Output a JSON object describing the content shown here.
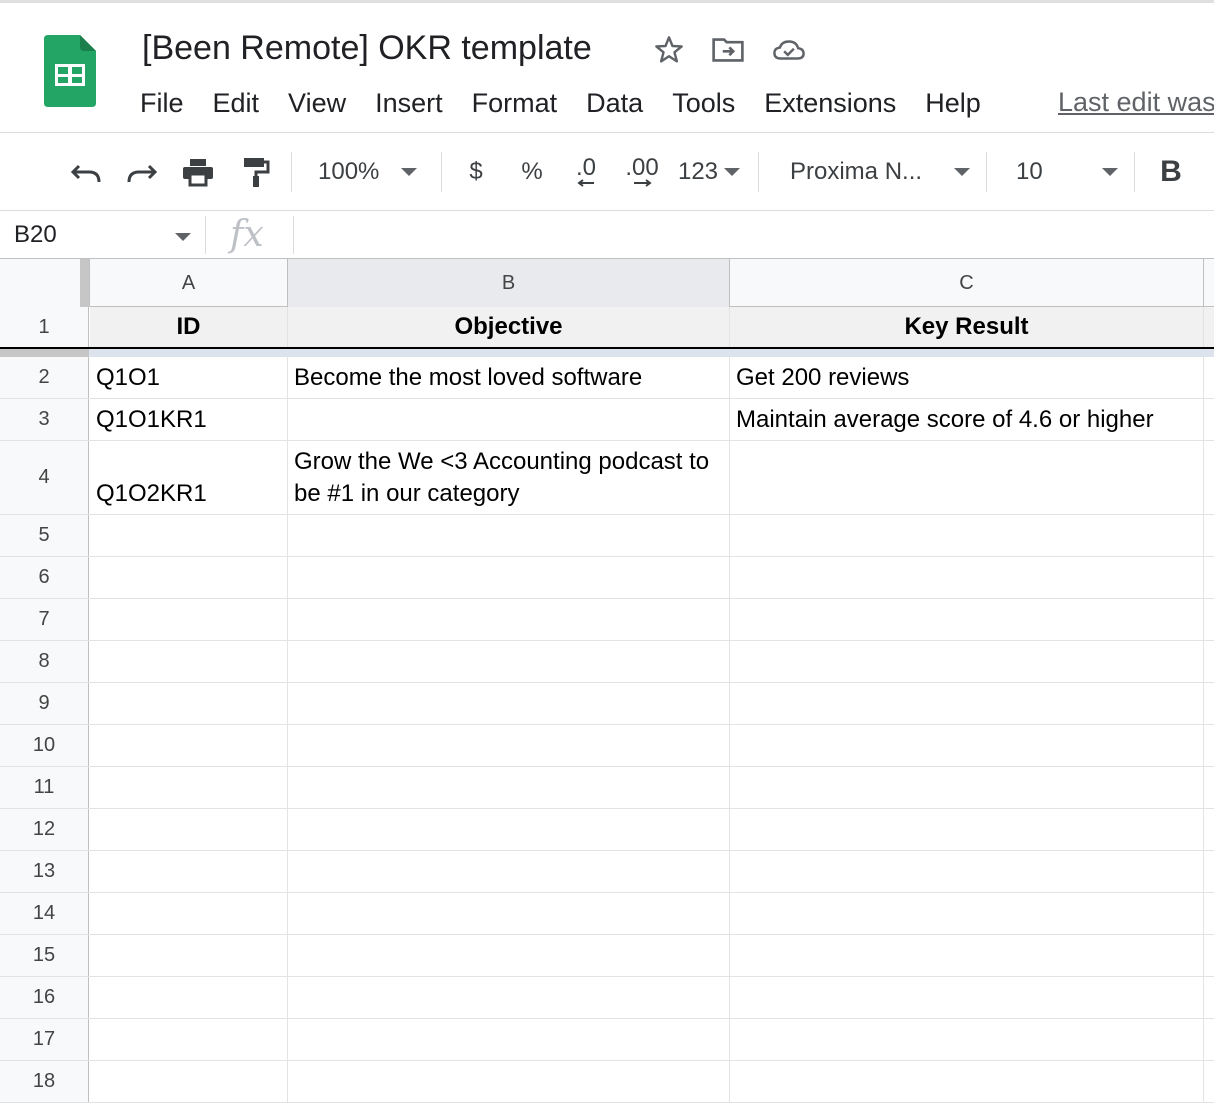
{
  "app": {
    "title": "[Been Remote] OKR template",
    "last_edit": "Last edit was"
  },
  "menu": [
    "File",
    "Edit",
    "View",
    "Insert",
    "Format",
    "Data",
    "Tools",
    "Extensions",
    "Help"
  ],
  "toolbar": {
    "zoom": "100%",
    "currency": "$",
    "percent": "%",
    "decrease_decimal": ".0",
    "increase_decimal": ".00",
    "more_formats": "123",
    "font": "Proxima N...",
    "font_size": "10",
    "bold": "B"
  },
  "formula_bar": {
    "cell_ref": "B20",
    "fx": "fx",
    "value": ""
  },
  "columns": [
    "A",
    "B",
    "C"
  ],
  "rows": [
    {
      "num": "1",
      "cells": [
        "ID",
        "Objective",
        "Key Result"
      ]
    },
    {
      "num": "2",
      "cells": [
        "Q1O1",
        "Become the most loved software",
        "Get 200 reviews"
      ]
    },
    {
      "num": "3",
      "cells": [
        "Q1O1KR1",
        "",
        "Maintain average score of 4.6 or higher"
      ]
    },
    {
      "num": "4",
      "cells": [
        "Q1O2KR1",
        "Grow the We <3 Accounting podcast to be #1 in our category",
        ""
      ]
    },
    {
      "num": "5",
      "cells": [
        "",
        "",
        ""
      ]
    },
    {
      "num": "6",
      "cells": [
        "",
        "",
        ""
      ]
    },
    {
      "num": "7",
      "cells": [
        "",
        "",
        ""
      ]
    },
    {
      "num": "8",
      "cells": [
        "",
        "",
        ""
      ]
    },
    {
      "num": "9",
      "cells": [
        "",
        "",
        ""
      ]
    },
    {
      "num": "10",
      "cells": [
        "",
        "",
        ""
      ]
    },
    {
      "num": "11",
      "cells": [
        "",
        "",
        ""
      ]
    },
    {
      "num": "12",
      "cells": [
        "",
        "",
        ""
      ]
    },
    {
      "num": "13",
      "cells": [
        "",
        "",
        ""
      ]
    },
    {
      "num": "14",
      "cells": [
        "",
        "",
        ""
      ]
    },
    {
      "num": "15",
      "cells": [
        "",
        "",
        ""
      ]
    },
    {
      "num": "16",
      "cells": [
        "",
        "",
        ""
      ]
    },
    {
      "num": "17",
      "cells": [
        "",
        "",
        ""
      ]
    },
    {
      "num": "18",
      "cells": [
        "",
        "",
        ""
      ]
    }
  ],
  "colors": {
    "sheets_green": "#23a566",
    "header_fill": "#f1f1f1",
    "freeze_bar": "#dde3ed"
  }
}
